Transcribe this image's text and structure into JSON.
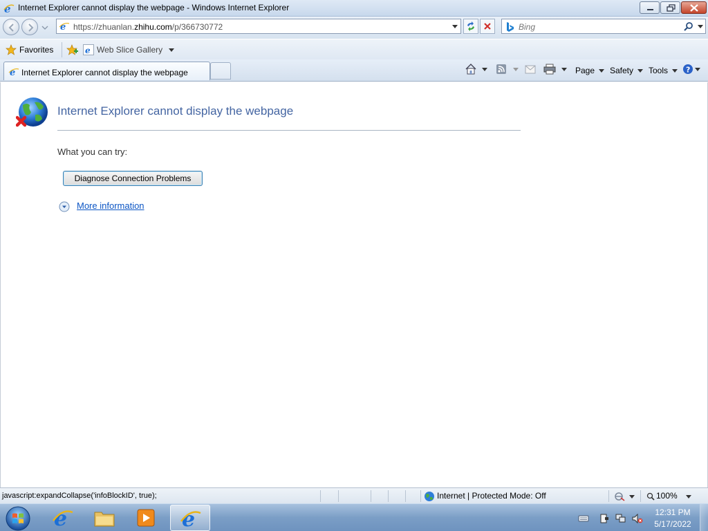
{
  "window": {
    "title": "Internet Explorer cannot display the webpage - Windows Internet Explorer"
  },
  "address": {
    "url_prefix": "https://zhuanlan.",
    "url_domain": "zhihu.com",
    "url_suffix": "/p/366730772"
  },
  "search": {
    "placeholder": "Bing"
  },
  "favorites_bar": {
    "favorites_label": "Favorites",
    "web_slice_label": "Web Slice Gallery"
  },
  "tabs": [
    {
      "label": "Internet Explorer cannot display the webpage"
    }
  ],
  "command_bar": {
    "page_label": "Page",
    "safety_label": "Safety",
    "tools_label": "Tools"
  },
  "error_page": {
    "title": "Internet Explorer cannot display the webpage",
    "try_label": "What you can try:",
    "diagnose_button": "Diagnose Connection Problems",
    "more_info_link": "More information"
  },
  "status_bar": {
    "status_text": "javascript:expandCollapse('infoBlockID', true);",
    "zone_text": "Internet | Protected Mode: Off",
    "zoom_text": "100%"
  },
  "taskbar": {
    "time": "12:31 PM",
    "date": "5/17/2022",
    "pinned": [
      "internet-explorer-icon",
      "file-explorer-icon",
      "media-player-icon",
      "internet-explorer-icon"
    ]
  },
  "colors": {
    "error_title": "#4465a2",
    "link": "#0b55c4",
    "close_button": "#c4452b"
  }
}
